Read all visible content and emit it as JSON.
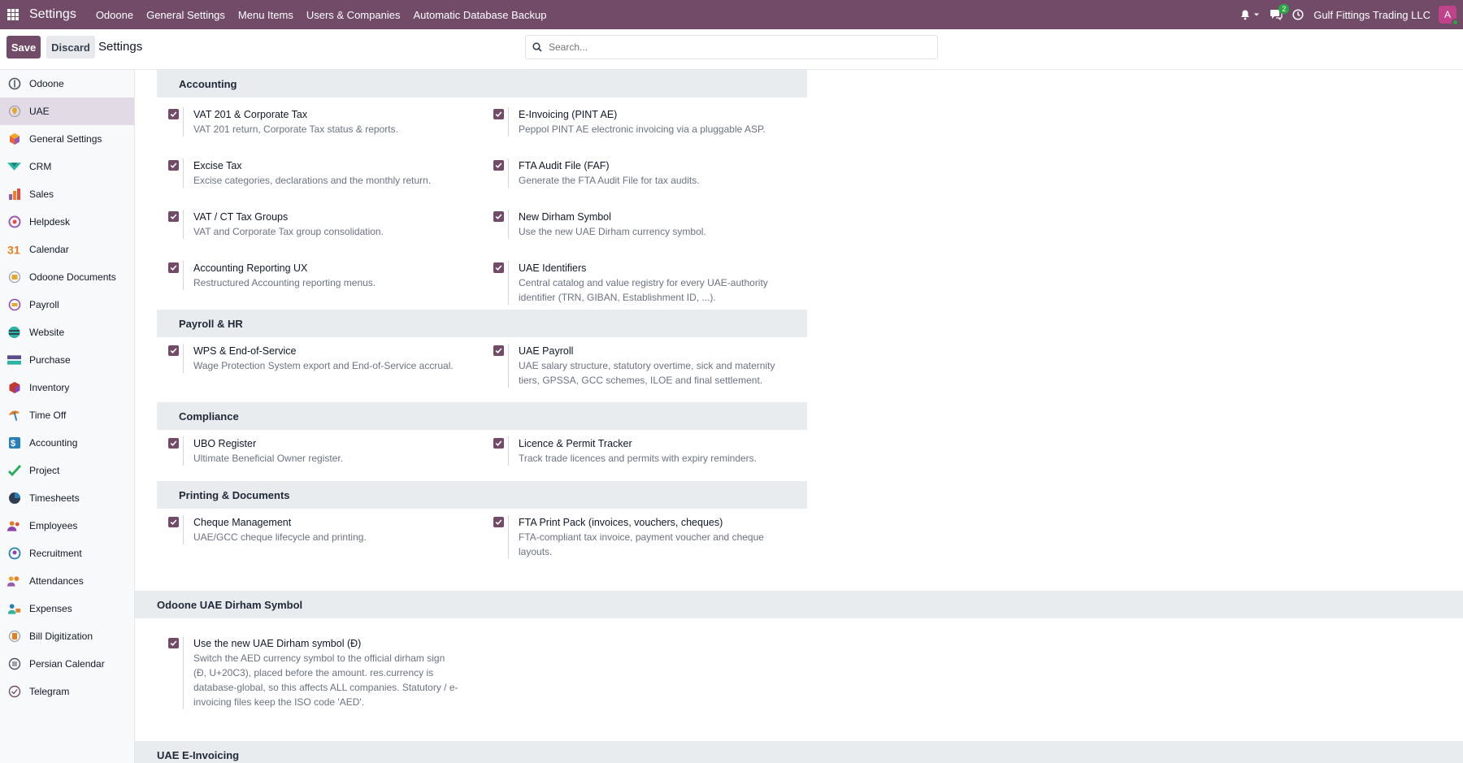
{
  "navbar": {
    "app_title": "Settings",
    "menu": [
      "Odoone",
      "General Settings",
      "Menu Items",
      "Users & Companies",
      "Automatic Database Backup"
    ],
    "message_count": "2",
    "company": "Gulf Fittings Trading LLC",
    "avatar_letter": "A"
  },
  "control_panel": {
    "save_label": "Save",
    "discard_label": "Discard",
    "title": "Settings",
    "search_placeholder": "Search..."
  },
  "sidebar": {
    "items": [
      {
        "label": "Odoone",
        "icon": "odoone-icon",
        "color": "#4b5563"
      },
      {
        "label": "UAE",
        "icon": "uae-icon",
        "color": "#e5a82e"
      },
      {
        "label": "General Settings",
        "icon": "general-settings-icon",
        "color": "#e8663a"
      },
      {
        "label": "CRM",
        "icon": "crm-icon",
        "color": "#2bb3a3"
      },
      {
        "label": "Sales",
        "icon": "sales-icon",
        "color": "#f0812a"
      },
      {
        "label": "Helpdesk",
        "icon": "helpdesk-icon",
        "color": "#9b59b6"
      },
      {
        "label": "Calendar",
        "icon": "calendar-icon",
        "color": "#e67e22"
      },
      {
        "label": "Odoone Documents",
        "icon": "documents-icon",
        "color": "#e5a82e"
      },
      {
        "label": "Payroll",
        "icon": "payroll-icon",
        "color": "#8e44ad"
      },
      {
        "label": "Website",
        "icon": "website-icon",
        "color": "#2bb3a3"
      },
      {
        "label": "Purchase",
        "icon": "purchase-icon",
        "color": "#5b4c8a"
      },
      {
        "label": "Inventory",
        "icon": "inventory-icon",
        "color": "#c0392b"
      },
      {
        "label": "Time Off",
        "icon": "time-off-icon",
        "color": "#e67e22"
      },
      {
        "label": "Accounting",
        "icon": "accounting-icon",
        "color": "#2980b9"
      },
      {
        "label": "Project",
        "icon": "project-icon",
        "color": "#27ae60"
      },
      {
        "label": "Timesheets",
        "icon": "timesheets-icon",
        "color": "#2c3e50"
      },
      {
        "label": "Employees",
        "icon": "employees-icon",
        "color": "#8e44ad"
      },
      {
        "label": "Recruitment",
        "icon": "recruitment-icon",
        "color": "#2980b9"
      },
      {
        "label": "Attendances",
        "icon": "attendances-icon",
        "color": "#e5a82e"
      },
      {
        "label": "Expenses",
        "icon": "expenses-icon",
        "color": "#2980b9"
      },
      {
        "label": "Bill Digitization",
        "icon": "bill-digitization-icon",
        "color": "#e67e22"
      },
      {
        "label": "Persian Calendar",
        "icon": "persian-calendar-icon",
        "color": "#4b5563"
      },
      {
        "label": "Telegram",
        "icon": "telegram-icon",
        "color": "#714B67"
      }
    ]
  },
  "sections": {
    "accounting": {
      "title": "Accounting",
      "settings": [
        {
          "title": "VAT 201 & Corporate Tax",
          "desc": "VAT 201 return, Corporate Tax status & reports."
        },
        {
          "title": "E-Invoicing (PINT AE)",
          "desc": "Peppol PINT AE electronic invoicing via a pluggable ASP."
        },
        {
          "title": "Excise Tax",
          "desc": "Excise categories, declarations and the monthly return."
        },
        {
          "title": "FTA Audit File (FAF)",
          "desc": "Generate the FTA Audit File for tax audits."
        },
        {
          "title": "VAT / CT Tax Groups",
          "desc": "VAT and Corporate Tax group consolidation."
        },
        {
          "title": "New Dirham Symbol",
          "desc": "Use the new UAE Dirham currency symbol."
        },
        {
          "title": "Accounting Reporting UX",
          "desc": "Restructured Accounting reporting menus."
        },
        {
          "title": "UAE Identifiers",
          "desc": "Central catalog and value registry for every UAE-authority identifier (TRN, GIBAN, Establishment ID, ...)."
        }
      ]
    },
    "payroll": {
      "title": "Payroll & HR",
      "settings": [
        {
          "title": "WPS & End-of-Service",
          "desc": "Wage Protection System export and End-of-Service accrual."
        },
        {
          "title": "UAE Payroll",
          "desc": "UAE salary structure, statutory overtime, sick and maternity tiers, GPSSA, GCC schemes, ILOE and final settlement."
        }
      ]
    },
    "compliance": {
      "title": "Compliance",
      "settings": [
        {
          "title": "UBO Register",
          "desc": "Ultimate Beneficial Owner register."
        },
        {
          "title": "Licence & Permit Tracker",
          "desc": "Track trade licences and permits with expiry reminders."
        }
      ]
    },
    "printing": {
      "title": "Printing & Documents",
      "settings": [
        {
          "title": "Cheque Management",
          "desc": "UAE/GCC cheque lifecycle and printing."
        },
        {
          "title": "FTA Print Pack (invoices, vouchers, cheques)",
          "desc": "FTA-compliant tax invoice, payment voucher and cheque layouts."
        }
      ]
    },
    "dirham": {
      "title": "Odoone UAE Dirham Symbol",
      "settings": [
        {
          "title": "Use the new UAE Dirham symbol (Đ)",
          "desc": "Switch the AED currency symbol to the official dirham sign (Đ, U+20C3), placed before the amount. res.currency is database-global, so this affects ALL companies. Statutory / e-invoicing files keep the ISO code 'AED'."
        }
      ]
    },
    "einvoicing": {
      "title": "UAE E-Invoicing"
    }
  }
}
